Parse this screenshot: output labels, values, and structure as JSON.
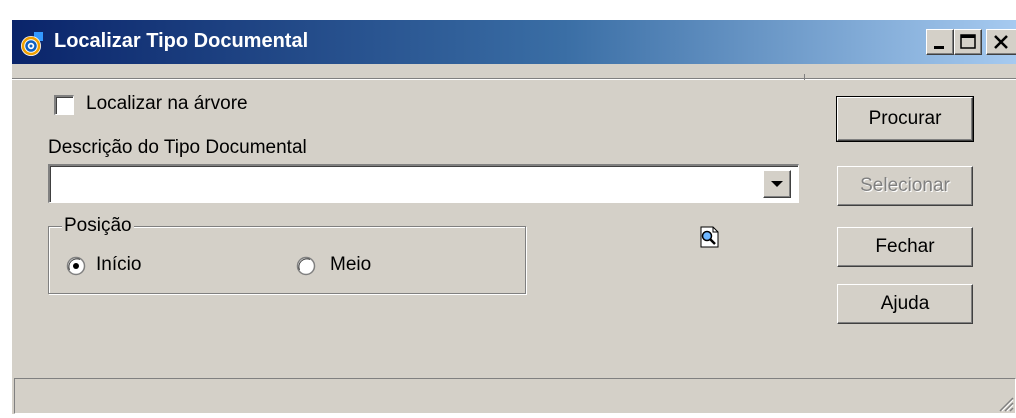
{
  "window": {
    "title": "Localizar Tipo Documental",
    "icon": "app-swirl-icon",
    "controls": [
      "minimize-icon",
      "maximize-icon",
      "close-icon"
    ]
  },
  "checkbox": {
    "label": "Localizar na árvore",
    "checked": false
  },
  "description": {
    "label": "Descrição do Tipo Documental",
    "value": ""
  },
  "position": {
    "legend": "Posição",
    "options": [
      {
        "label": "Início",
        "selected": true
      },
      {
        "label": "Meio",
        "selected": false
      }
    ]
  },
  "buttons": {
    "search": "Procurar",
    "select": "Selecionar",
    "close": "Fechar",
    "help": "Ajuda"
  },
  "status": {
    "text": ""
  },
  "colors": {
    "face": "#d4d0c8",
    "title_start": "#0a246a",
    "title_end": "#a6caf0",
    "disabled_text": "#808080"
  }
}
